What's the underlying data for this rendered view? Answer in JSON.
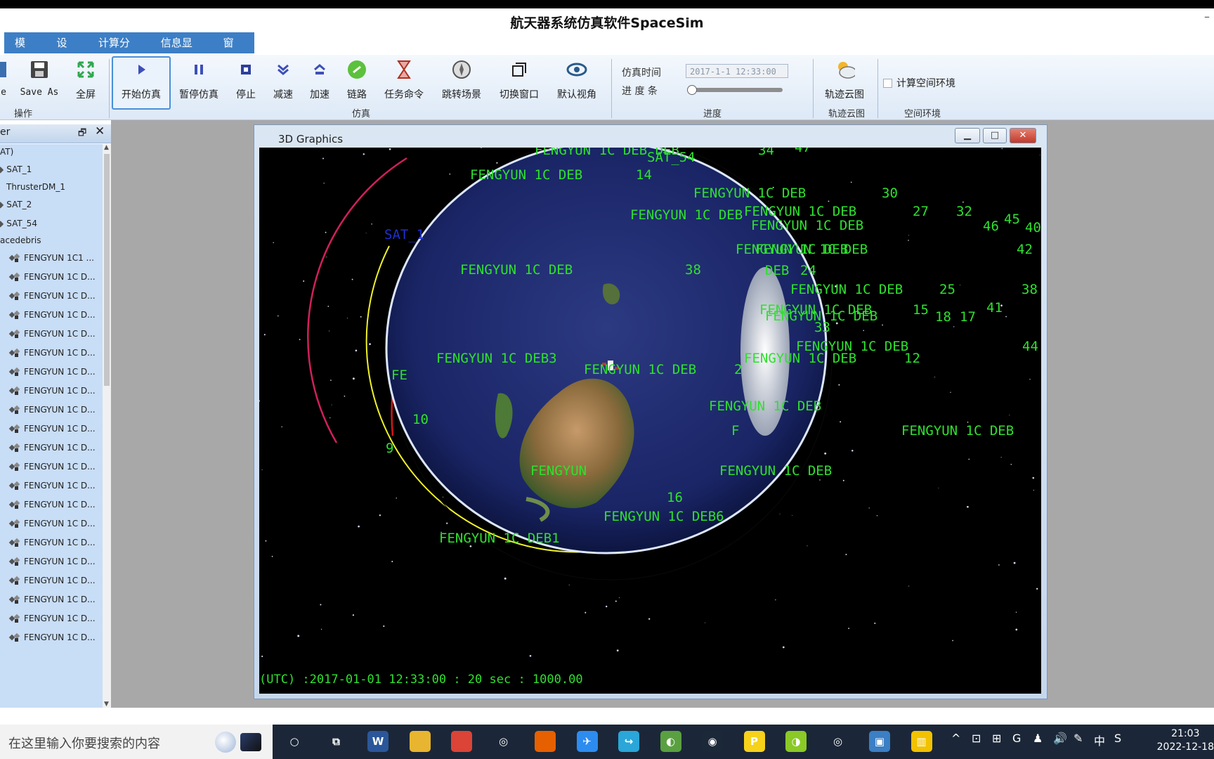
{
  "app": {
    "title": "航天器系统仿真软件SpaceSim",
    "minimize_glyph": "–"
  },
  "menu": [
    "模型",
    "设置",
    "计算分析",
    "信息显示",
    "窗口"
  ],
  "ribbon": {
    "buttons": [
      {
        "label": "e",
        "icon": "save-icon"
      },
      {
        "label": "Save As",
        "icon": "save-as-icon"
      },
      {
        "label": "全屏",
        "icon": "fullscreen-icon"
      },
      {
        "label": "开始仿真",
        "icon": "play-icon"
      },
      {
        "label": "暂停仿真",
        "icon": "pause-icon"
      },
      {
        "label": "停止",
        "icon": "stop-icon"
      },
      {
        "label": "减速",
        "icon": "slow-down-icon"
      },
      {
        "label": "加速",
        "icon": "speed-up-icon"
      },
      {
        "label": "链路",
        "icon": "link-icon"
      },
      {
        "label": "任务命令",
        "icon": "hourglass-icon"
      },
      {
        "label": "跳转场景",
        "icon": "compass-icon"
      },
      {
        "label": "切换窗口",
        "icon": "switch-window-icon"
      },
      {
        "label": "默认视角",
        "icon": "eye-icon"
      },
      {
        "label": "轨迹云图",
        "icon": "cloud-sun-icon"
      }
    ],
    "groups": [
      "操作",
      "仿真",
      "进度",
      "轨迹云图",
      "空间环境"
    ],
    "sim_time_label": "仿真时间",
    "sim_time_value": "2017-1-1 12:33:00",
    "progress_label": "进 度 条",
    "progress": 0.0,
    "env_checkbox_label": "计算空间环境",
    "env_checkbox_checked": false
  },
  "panel": {
    "header": "er",
    "pin_glyph": "🗗",
    "close_glyph": "✕",
    "tree": [
      {
        "label": "AT)"
      },
      {
        "label": "SAT_1"
      },
      {
        "label": "ThrusterDM_1"
      },
      {
        "label": "SAT_2"
      },
      {
        "label": "SAT_54"
      },
      {
        "label": "acedebris"
      }
    ],
    "debris": [
      "FENGYUN 1C1 ...",
      "FENGYUN 1C D...",
      "FENGYUN 1C D...",
      "FENGYUN 1C D...",
      "FENGYUN 1C D...",
      "FENGYUN 1C D...",
      "FENGYUN 1C D...",
      "FENGYUN 1C D...",
      "FENGYUN 1C D...",
      "FENGYUN 1C D...",
      "FENGYUN 1C D...",
      "FENGYUN 1C D...",
      "FENGYUN 1C D...",
      "FENGYUN 1C D...",
      "FENGYUN 1C D...",
      "FENGYUN 1C D...",
      "FENGYUN 1C D...",
      "FENGYUN 1C D...",
      "FENGYUN 1C D...",
      "FENGYUN 1C D...",
      "FENGYUN 1C D..."
    ]
  },
  "graphics": {
    "title": "3D Graphics",
    "status": "(UTC) :2017-01-01 12:33:00  : 20 sec   : 1000.00",
    "labels": [
      {
        "t": "FENGYUN 1C DEB DEB",
        "c": "#2fe02f"
      },
      {
        "t": "SAT_54",
        "c": "#2fe02f"
      },
      {
        "t": "34",
        "c": "#2fe02f"
      },
      {
        "t": "47",
        "c": "#2fe02f"
      },
      {
        "t": "FENGYUN 1C DEB",
        "c": "#2fe02f"
      },
      {
        "t": "14",
        "c": "#2fe02f"
      },
      {
        "t": "FENGYUN 1C DEB",
        "c": "#2fe02f"
      },
      {
        "t": "30",
        "c": "#2fe02f"
      },
      {
        "t": "FENGYUN 1C DEB",
        "c": "#2fe02f"
      },
      {
        "t": "FENGYUN 1C DEB",
        "c": "#2fe02f"
      },
      {
        "t": "27",
        "c": "#2fe02f"
      },
      {
        "t": "32",
        "c": "#2fe02f"
      },
      {
        "t": "FENGYUN 1C DEB",
        "c": "#2fe02f"
      },
      {
        "t": "45",
        "c": "#2fe02f"
      },
      {
        "t": "46",
        "c": "#2fe02f"
      },
      {
        "t": "40",
        "c": "#2fe02f"
      },
      {
        "t": "FENGYUN 1C DEB",
        "c": "#2fe02f"
      },
      {
        "t": "FENGYUN 1C DEB",
        "c": "#2fe02f"
      },
      {
        "t": "42",
        "c": "#2fe02f"
      },
      {
        "t": "SAT_1",
        "c": "#1f2fcf"
      },
      {
        "t": "FENGYUN 1C DEB",
        "c": "#2fe02f"
      },
      {
        "t": "38",
        "c": "#2fe02f"
      },
      {
        "t": "DEB",
        "c": "#2fe02f"
      },
      {
        "t": "24",
        "c": "#2fe02f"
      },
      {
        "t": "FENGYUN 1C DEB",
        "c": "#2fe02f"
      },
      {
        "t": "25",
        "c": "#2fe02f"
      },
      {
        "t": "38",
        "c": "#2fe02f"
      },
      {
        "t": "FENGYUN 1C DEB",
        "c": "#2fe02f"
      },
      {
        "t": "15",
        "c": "#2fe02f"
      },
      {
        "t": "18",
        "c": "#2fe02f"
      },
      {
        "t": "17",
        "c": "#2fe02f"
      },
      {
        "t": "41",
        "c": "#2fe02f"
      },
      {
        "t": "FENGYUN 1C DEB",
        "c": "#2fe02f"
      },
      {
        "t": "33",
        "c": "#2fe02f"
      },
      {
        "t": "FENGYUN 1C DEB",
        "c": "#2fe02f"
      },
      {
        "t": "44",
        "c": "#2fe02f"
      },
      {
        "t": "FENGYUN 1C DEB3",
        "c": "#2fe02f"
      },
      {
        "t": "FENGYUN 1C DEB",
        "c": "#2fe02f"
      },
      {
        "t": "12",
        "c": "#2fe02f"
      },
      {
        "t": "FE",
        "c": "#2fe02f"
      },
      {
        "t": "FENGYUN 1C DEB",
        "c": "#2fe02f"
      },
      {
        "t": "2",
        "c": "#2fe02f"
      },
      {
        "t": "FENGYUN 1C DEB",
        "c": "#2fe02f"
      },
      {
        "t": "10",
        "c": "#2fe02f"
      },
      {
        "t": "F",
        "c": "#2fe02f"
      },
      {
        "t": "FENGYUN 1C DEB",
        "c": "#2fe02f"
      },
      {
        "t": "9",
        "c": "#2fe02f"
      },
      {
        "t": "FENGYUN",
        "c": "#2fe02f"
      },
      {
        "t": "FENGYUN 1C DEB",
        "c": "#2fe02f"
      },
      {
        "t": "16",
        "c": "#2fe02f"
      },
      {
        "t": "FENGYUN 1C DEB6",
        "c": "#2fe02f"
      },
      {
        "t": "FENGYUN 1C DEB1",
        "c": "#2fe02f"
      },
      {
        "t": "FENGYUN 1C DEB 7",
        "c": "#2fe02f"
      }
    ]
  },
  "taskbar": {
    "search_placeholder": "在这里输入你要搜索的内容",
    "apps": [
      {
        "icon": "cortana-icon",
        "glyph": "○",
        "bg": "transparent"
      },
      {
        "icon": "task-view-icon",
        "glyph": "⧉",
        "bg": "transparent"
      },
      {
        "icon": "word-icon",
        "glyph": "W",
        "bg": "#2b579a"
      },
      {
        "icon": "folder-icon",
        "glyph": "",
        "bg": "#e8b530"
      },
      {
        "icon": "chrome-icon",
        "glyph": "",
        "bg": "#db4437"
      },
      {
        "icon": "spiral-app-icon",
        "glyph": "◎",
        "bg": "transparent"
      },
      {
        "icon": "firefox-icon",
        "glyph": "",
        "bg": "#e66000"
      },
      {
        "icon": "bird-app-icon",
        "glyph": "✈",
        "bg": "#2d8cf0"
      },
      {
        "icon": "share-app-icon",
        "glyph": "↪",
        "bg": "#2aa6d8"
      },
      {
        "icon": "globe-app-icon",
        "glyph": "◐",
        "bg": "#5aa040"
      },
      {
        "icon": "steam-icon",
        "glyph": "◉",
        "bg": "#1b2838"
      },
      {
        "icon": "yellow-app-icon",
        "glyph": "P",
        "bg": "#f6d21b"
      },
      {
        "icon": "green-app-icon",
        "glyph": "◑",
        "bg": "#8ac926"
      },
      {
        "icon": "aperture-icon",
        "glyph": "◎",
        "bg": "transparent"
      },
      {
        "icon": "spacesim-app-icon",
        "glyph": "▣",
        "bg": "#3b7fc4"
      },
      {
        "icon": "chart-app-icon",
        "glyph": "▥",
        "bg": "#f2c200"
      }
    ],
    "tray": [
      "^",
      "⊡",
      "⊞",
      "G",
      "♟",
      "🔊",
      "✎",
      "中",
      "S"
    ],
    "time": "21:03",
    "date": "2022-12-18"
  },
  "colors": {
    "accent": "#3d7fc6",
    "label_green": "#2fe02f",
    "sat_blue": "#1f2fcf"
  }
}
